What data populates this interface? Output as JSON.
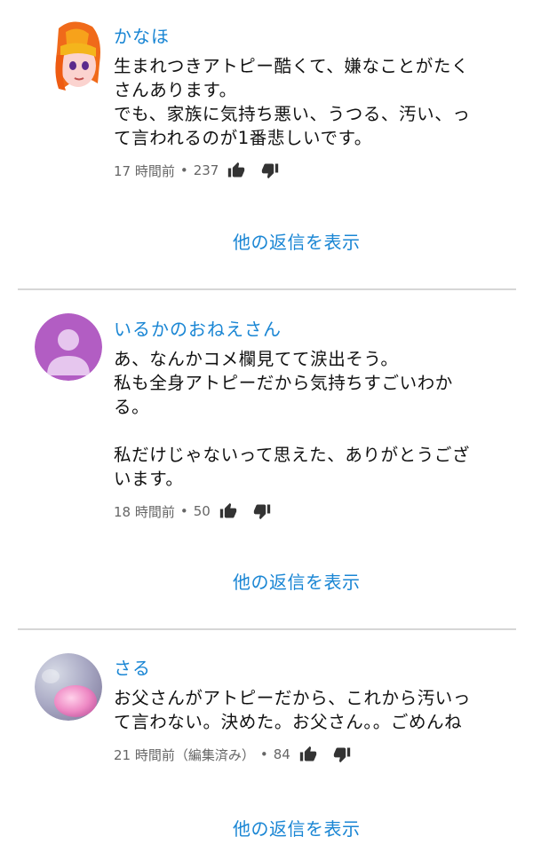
{
  "comments": [
    {
      "author": "かなほ",
      "lines": [
        "生まれつきアトピー酷くて、嫌なことがたく",
        "さんあります。",
        "でも、家族に気持ち悪い、うつる、汚い、っ",
        "て言われるのが1番悲しいです。"
      ],
      "time": "17 時間前",
      "likes": "237",
      "avatar_icon": "anime-girl-avatar",
      "replies_label": "他の返信を表示"
    },
    {
      "author": "いるかのおねえさん",
      "lines": [
        "あ、なんかコメ欄見てて涙出そう。",
        "私も全身アトピーだから気持ちすごいわか",
        "る。",
        "",
        "私だけじゃないって思えた、ありがとうござ",
        "います。"
      ],
      "time": "18 時間前",
      "likes": "50",
      "avatar_icon": "default-user-avatar",
      "replies_label": "他の返信を表示"
    },
    {
      "author": "さる",
      "lines": [
        "お父さんがアトピーだから、これから汚いっ",
        "て言わない。決めた。お父さん。。ごめんね"
      ],
      "time": "21 時間前（編集済み）",
      "likes": "84",
      "avatar_icon": "photo-avatar",
      "replies_label": "他の返信を表示"
    }
  ],
  "separator": "•",
  "colors": {
    "link": "#1a86d4",
    "meta": "#666666",
    "divider": "#d6d6d6",
    "default_avatar": "#b25dc3"
  }
}
